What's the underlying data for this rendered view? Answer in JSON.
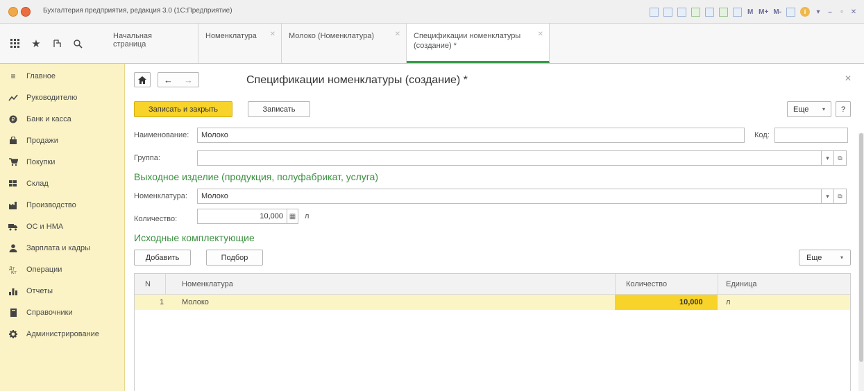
{
  "window": {
    "title": "Бухгалтерия предприятия, редакция 3.0 (1С:Предприятие)",
    "tools": [
      "M",
      "M+",
      "M-"
    ]
  },
  "tabs": [
    {
      "label": "Начальная страница",
      "line2": "",
      "closable": false
    },
    {
      "label": "Номенклатура",
      "line2": "",
      "closable": true
    },
    {
      "label": "Молоко (Номенклатура)",
      "line2": "",
      "closable": true
    },
    {
      "label": "Спецификации номенклатуры",
      "line2": "(создание) *",
      "closable": true,
      "active": true
    }
  ],
  "sidebar": {
    "items": [
      {
        "label": "Главное",
        "icon": "menu-icon"
      },
      {
        "label": "Руководителю",
        "icon": "chart-line-icon"
      },
      {
        "label": "Банк и касса",
        "icon": "coin-icon"
      },
      {
        "label": "Продажи",
        "icon": "bag-icon"
      },
      {
        "label": "Покупки",
        "icon": "cart-icon"
      },
      {
        "label": "Склад",
        "icon": "warehouse-icon"
      },
      {
        "label": "Производство",
        "icon": "factory-icon"
      },
      {
        "label": "ОС и НМА",
        "icon": "truck-icon"
      },
      {
        "label": "Зарплата и кадры",
        "icon": "person-icon"
      },
      {
        "label": "Операции",
        "icon": "operations-icon"
      },
      {
        "label": "Отчеты",
        "icon": "bar-chart-icon"
      },
      {
        "label": "Справочники",
        "icon": "book-icon"
      },
      {
        "label": "Администрирование",
        "icon": "gear-icon"
      }
    ]
  },
  "form": {
    "title": "Спецификации номенклатуры (создание) *",
    "save_close_label": "Записать и закрыть",
    "save_label": "Записать",
    "more_label": "Еще",
    "help_label": "?",
    "name_label": "Наименование:",
    "name_value": "Молоко",
    "code_label": "Код:",
    "code_value": "",
    "group_label": "Группа:",
    "group_value": "",
    "output_section": "Выходное изделие (продукция, полуфабрикат, услуга)",
    "nomenclature_label": "Номенклатура:",
    "nomenclature_value": "Молоко",
    "quantity_label": "Количество:",
    "quantity_value": "10,000",
    "unit_value": "л",
    "components_section": "Исходные комплектующие",
    "add_label": "Добавить",
    "pick_label": "Подбор",
    "table_more_label": "Еще"
  },
  "table": {
    "columns": [
      "N",
      "Номенклатура",
      "Количество",
      "Единица"
    ],
    "rows": [
      {
        "n": "1",
        "nomenclature": "Молоко",
        "quantity": "10,000",
        "unit": "л"
      }
    ]
  },
  "colors": {
    "accent_yellow": "#f8d32a",
    "sidebar_bg": "#fbf3c5",
    "section_green": "#3a8f3f",
    "active_tab_underline": "#3a9a4a"
  }
}
